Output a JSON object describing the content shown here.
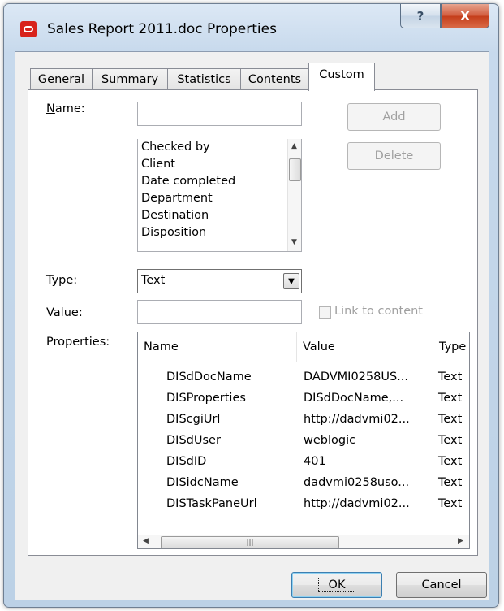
{
  "window": {
    "title": "Sales Report 2011.doc Properties",
    "help_glyph": "?",
    "close_glyph": "X"
  },
  "tabs": [
    {
      "label": "General",
      "active": false
    },
    {
      "label": "Summary",
      "active": false
    },
    {
      "label": "Statistics",
      "active": false
    },
    {
      "label": "Contents",
      "active": false
    },
    {
      "label": "Custom",
      "active": true
    }
  ],
  "custom": {
    "name_label": "Name:",
    "name_value": "",
    "name_options": [
      "Checked by",
      "Client",
      "Date completed",
      "Department",
      "Destination",
      "Disposition"
    ],
    "add_label": "Add",
    "delete_label": "Delete",
    "type_label": "Type:",
    "type_value": "Text",
    "value_label": "Value:",
    "value_value": "",
    "link_to_content_label": "Link to content",
    "link_to_content_checked": false,
    "properties_label": "Properties:",
    "properties_columns": [
      "Name",
      "Value",
      "Type"
    ],
    "properties_rows": [
      {
        "name": "DISdDocName",
        "value": "DADVMI0258US...",
        "type": "Text"
      },
      {
        "name": "DISProperties",
        "value": "DISdDocName,...",
        "type": "Text"
      },
      {
        "name": "DIScgiUrl",
        "value": "http://dadvmi02...",
        "type": "Text"
      },
      {
        "name": "DISdUser",
        "value": "weblogic",
        "type": "Text"
      },
      {
        "name": "DISdID",
        "value": "401",
        "type": "Text"
      },
      {
        "name": "DISidcName",
        "value": "dadvmi0258uso...",
        "type": "Text"
      },
      {
        "name": "DISTaskPaneUrl",
        "value": "http://dadvmi02...",
        "type": "Text"
      }
    ]
  },
  "buttons": {
    "ok": "OK",
    "cancel": "Cancel"
  },
  "colors": {
    "title_bar": "#c7d9ec",
    "close_button": "#c43d1a",
    "app_logo": "#d8231c"
  }
}
